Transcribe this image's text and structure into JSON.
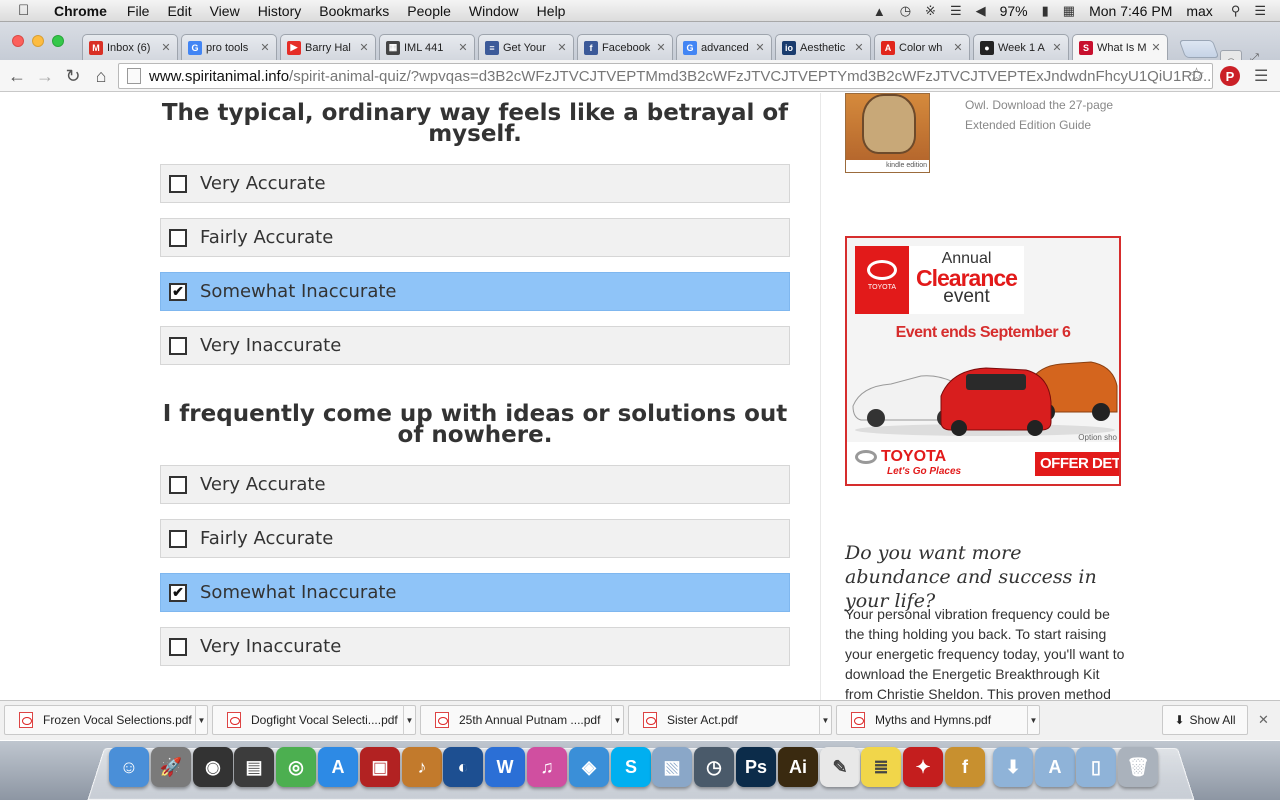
{
  "menubar": {
    "app": "Chrome",
    "items": [
      "File",
      "Edit",
      "View",
      "History",
      "Bookmarks",
      "People",
      "Window",
      "Help"
    ],
    "battery": "97%",
    "clock": "Mon 7:46 PM",
    "user": "max"
  },
  "tabs": [
    {
      "label": "Inbox (6)",
      "favicon": "gmail-icon",
      "color": "#d93025",
      "glyph": "M"
    },
    {
      "label": "pro tools",
      "favicon": "google-icon",
      "color": "#4285f4",
      "glyph": "G"
    },
    {
      "label": "Barry Hal",
      "favicon": "youtube-icon",
      "color": "#e52d27",
      "glyph": "▶"
    },
    {
      "label": "IML 441",
      "favicon": "image-icon",
      "color": "#444444",
      "glyph": "▦"
    },
    {
      "label": "Get Your",
      "favicon": "flag-icon",
      "color": "#3c5a99",
      "glyph": "≡"
    },
    {
      "label": "Facebook",
      "favicon": "facebook-icon",
      "color": "#3b5998",
      "glyph": "f"
    },
    {
      "label": "advanced",
      "favicon": "google-icon",
      "color": "#4285f4",
      "glyph": "G"
    },
    {
      "label": "Aesthetic",
      "favicon": "site-icon",
      "color": "#1a3c6e",
      "glyph": "io"
    },
    {
      "label": "Color wh",
      "favicon": "adobe-icon",
      "color": "#e1261c",
      "glyph": "A"
    },
    {
      "label": "Week 1 A",
      "favicon": "github-icon",
      "color": "#222222",
      "glyph": "●"
    },
    {
      "label": "What Is M",
      "favicon": "spiritanimal-icon",
      "color": "#c8102e",
      "glyph": "S"
    }
  ],
  "address": {
    "domain": "www.spiritanimal.info",
    "path": "/spirit-animal-quiz/?wpvqas=d3B2cWFzJTVCJTVEPTMmd3B2cWFzJTVCJTVEPTYmd3B2cWFzJTVCJTVEPTExJndwdnFhcyU1QiU1RD..."
  },
  "quiz": {
    "questions": [
      {
        "text": "The typical, ordinary way feels like a betrayal of myself.",
        "options": [
          {
            "label": "Very Accurate",
            "checked": false
          },
          {
            "label": "Fairly Accurate",
            "checked": false
          },
          {
            "label": "Somewhat Inaccurate",
            "checked": true
          },
          {
            "label": "Very Inaccurate",
            "checked": false
          }
        ]
      },
      {
        "text": "I frequently come up with ideas or solutions out of nowhere.",
        "options": [
          {
            "label": "Very Accurate",
            "checked": false
          },
          {
            "label": "Fairly Accurate",
            "checked": false
          },
          {
            "label": "Somewhat Inaccurate",
            "checked": true
          },
          {
            "label": "Very Inaccurate",
            "checked": false
          }
        ]
      }
    ]
  },
  "sidebar": {
    "book_badge": "kindle edition",
    "book_text_line1": "Owl. Download the 27-page",
    "book_text_line2": "Extended Edition Guide",
    "ad": {
      "brand": "TOYOTA",
      "annual": "Annual",
      "clearance": "Clearance",
      "event": "event",
      "ends": "Event ends September 6",
      "option_note": "Option sho",
      "footer_brand": "TOYOTA",
      "tagline": "Let's Go Places",
      "cta": "OFFER DETAIL"
    },
    "abundance_title": "Do you want more abundance and success in your life?",
    "abundance_body": "Your personal vibration frequency could be the thing holding you back. To start raising your energetic frequency today, you'll want to download the Energetic Breakthrough Kit from Christie Sheldon. This proven method"
  },
  "downloads": [
    "Frozen Vocal Selections.pdf",
    "Dogfight Vocal Selecti....pdf",
    "25th Annual Putnam ....pdf",
    "Sister Act.pdf",
    "Myths and Hymns.pdf"
  ],
  "show_all": "Show All",
  "dock": [
    {
      "name": "finder-icon",
      "color": "#4a8fd8",
      "glyph": "☺"
    },
    {
      "name": "launchpad-icon",
      "color": "#7a7a7a",
      "glyph": "🚀"
    },
    {
      "name": "dashboard-icon",
      "color": "#333333",
      "glyph": "◉"
    },
    {
      "name": "mission-control-icon",
      "color": "#3c3c3c",
      "glyph": "▤"
    },
    {
      "name": "chrome-icon",
      "color": "#4caf50",
      "glyph": "◎"
    },
    {
      "name": "app-store-icon",
      "color": "#2d8ae5",
      "glyph": "A"
    },
    {
      "name": "photo-booth-icon",
      "color": "#b22222",
      "glyph": "▣"
    },
    {
      "name": "garageband-icon",
      "color": "#c27a2c",
      "glyph": "♪"
    },
    {
      "name": "google-earth-icon",
      "color": "#1d4f91",
      "glyph": "◐"
    },
    {
      "name": "word-icon",
      "color": "#2b6fd6",
      "glyph": "W"
    },
    {
      "name": "itunes-icon",
      "color": "#d04fa0",
      "glyph": "♫"
    },
    {
      "name": "safari-icon",
      "color": "#3a8fd8",
      "glyph": "◈"
    },
    {
      "name": "skype-icon",
      "color": "#00aff0",
      "glyph": "S"
    },
    {
      "name": "preview-icon",
      "color": "#8aa7c8",
      "glyph": "▧"
    },
    {
      "name": "time-machine-icon",
      "color": "#4a5a6a",
      "glyph": "◷"
    },
    {
      "name": "photoshop-icon",
      "color": "#0c2c4a",
      "glyph": "Ps"
    },
    {
      "name": "illustrator-icon",
      "color": "#3a2a10",
      "glyph": "Ai"
    },
    {
      "name": "textedit-icon",
      "color": "#e8e8e8",
      "glyph": "✎"
    },
    {
      "name": "stickies-icon",
      "color": "#f1d64a",
      "glyph": "≣"
    },
    {
      "name": "acrobat-icon",
      "color": "#c41e1e",
      "glyph": "✦"
    },
    {
      "name": "fontlab-icon",
      "color": "#c8902f",
      "glyph": "f"
    },
    {
      "name": "downloads-folder-icon",
      "color": "#8fb3d8",
      "glyph": "⬇"
    },
    {
      "name": "applications-folder-icon",
      "color": "#8fb3d8",
      "glyph": "A"
    },
    {
      "name": "documents-folder-icon",
      "color": "#8fb3d8",
      "glyph": "▯"
    },
    {
      "name": "trash-icon",
      "color": "#aab2bc",
      "glyph": "🗑"
    }
  ]
}
